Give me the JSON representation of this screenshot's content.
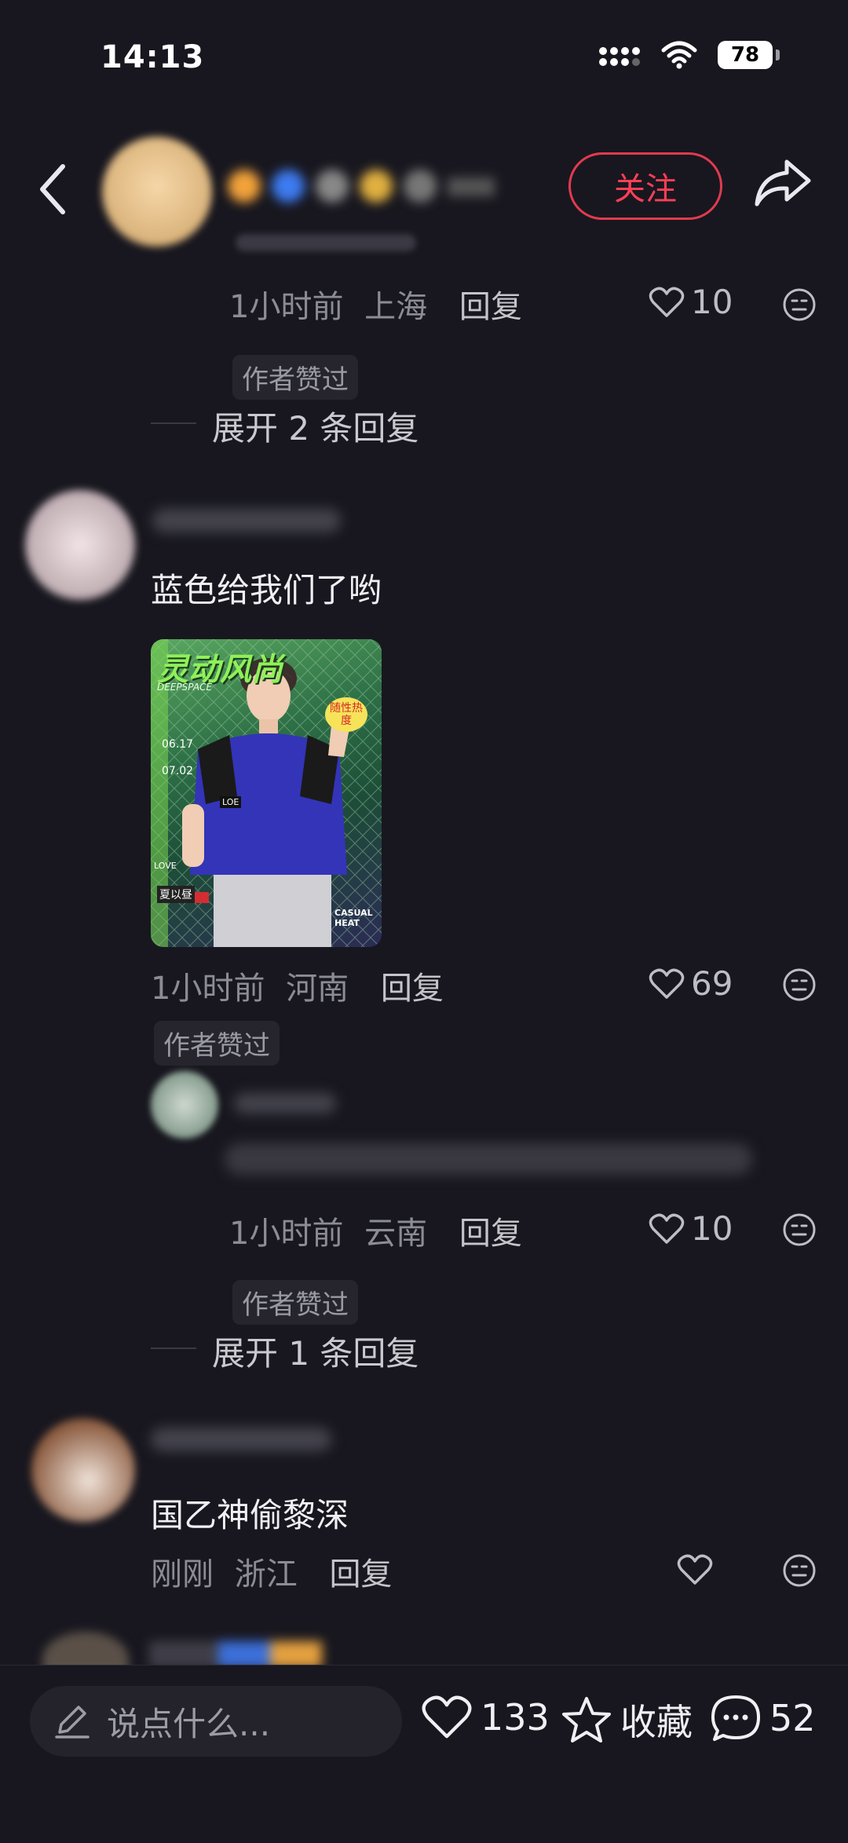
{
  "status": {
    "time": "14:13",
    "battery": "78"
  },
  "header": {
    "follow_label": "关注"
  },
  "comments": {
    "c0": {
      "time": "1小时前",
      "location": "上海",
      "reply": "回复",
      "likes": "10",
      "badge": "作者赞过",
      "expand": "展开 2 条回复"
    },
    "c1": {
      "text": "蓝色给我们了哟",
      "time": "1小时前",
      "location": "河南",
      "reply": "回复",
      "likes": "69",
      "badge": "作者赞过"
    },
    "c1_sub": {
      "time": "1小时前",
      "location": "云南",
      "reply": "回复",
      "likes": "10",
      "badge": "作者赞过",
      "expand": "展开 1 条回复"
    },
    "c2": {
      "text": "国乙神偷黎深",
      "time": "刚刚",
      "location": "浙江",
      "reply": "回复"
    }
  },
  "image_card": {
    "title": "灵动风尚",
    "brand": "DEEPSPACE",
    "dates": [
      "06.17",
      "07.02"
    ],
    "tag": "随性热度",
    "jersey": "LOE",
    "name": "夏以昼",
    "footer": "CASUAL HEAT",
    "love": "LOVE"
  },
  "bottom_bar": {
    "input_placeholder": "说点什么...",
    "likes": "133",
    "collect_label": "收藏",
    "comments": "52"
  },
  "colors": {
    "background": "#18171f",
    "accent": "#ff3f57"
  }
}
